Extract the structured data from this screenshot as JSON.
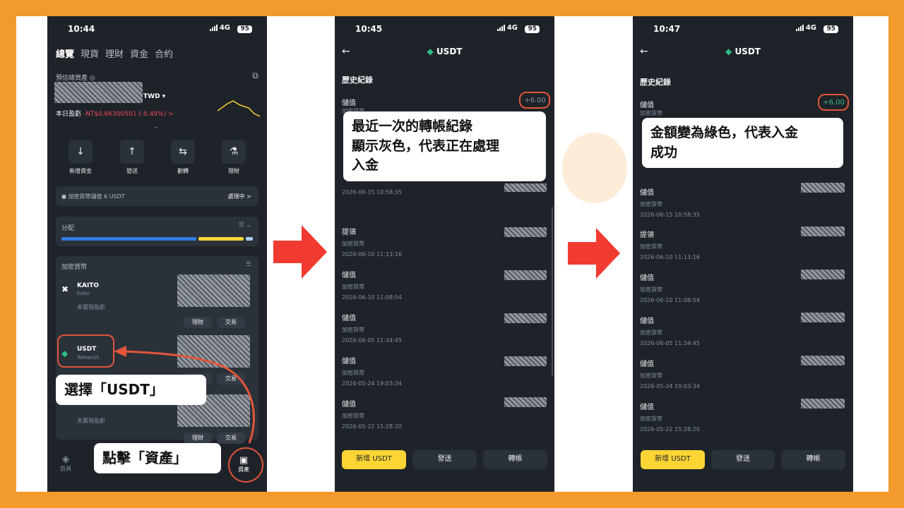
{
  "phone1": {
    "time": "10:44",
    "network": "4G",
    "battery": "95",
    "tabs": [
      "總覽",
      "現貨",
      "理財",
      "資金",
      "合約"
    ],
    "estimated_label": "預估總資產",
    "currency": "TWD ▾",
    "pnl_label": "本日盈虧",
    "pnl_value": "-NT$0.66300501 (-0.49%) >",
    "actions": [
      {
        "label": "新增資金",
        "icon": "↓"
      },
      {
        "label": "發送",
        "icon": "↑"
      },
      {
        "label": "劃轉",
        "icon": "⇆"
      },
      {
        "label": "理財",
        "icon": "⚗"
      }
    ],
    "notice_text": "● 加密貨幣儲值 6 USDT",
    "notice_status": "處理中 >",
    "allocation_label": "分配",
    "crypto_label": "加密貨幣",
    "coins": [
      {
        "name": "KAITO",
        "sub": "Kaito",
        "pnl": "未實現盈虧",
        "btn1": "理財",
        "btn2": "交易"
      },
      {
        "name": "USDT",
        "sub": "TetherUS",
        "btn1": "理財",
        "btn2": "交易"
      },
      {
        "pnl": "未實現盈虧",
        "btn1": "理財",
        "btn2": "交易"
      }
    ],
    "nav_home": "首頁",
    "nav_assets": "資產"
  },
  "phone2": {
    "time": "10:45",
    "network": "4G",
    "battery": "95",
    "title": "USDT",
    "history_label": "歷史紀錄",
    "first_type": "儲值",
    "first_amount": "+6.00",
    "first_sub": "加密貨幣",
    "records": [
      {
        "type": "儲值",
        "sub": "加密貨幣",
        "time": "2026-06-15 10:58:35"
      },
      {
        "type": "提領",
        "sub": "加密貨幣",
        "time": "2026-06-10 11:13:16"
      },
      {
        "type": "儲值",
        "sub": "加密貨幣",
        "time": "2026-06-10 11:08:54"
      },
      {
        "type": "儲值",
        "sub": "加密貨幣",
        "time": "2026-06-05 11:34:45"
      },
      {
        "type": "儲值",
        "sub": "加密貨幣",
        "time": "2026-05-24 19:03:34"
      },
      {
        "type": "儲值",
        "sub": "加密貨幣",
        "time": "2026-05-22 15:28:20"
      }
    ],
    "btn_add": "新增 USDT",
    "btn_send": "發送",
    "btn_transfer": "轉帳"
  },
  "phone3": {
    "time": "10:47",
    "network": "4G",
    "battery": "95",
    "title": "USDT",
    "history_label": "歷史紀錄",
    "first_type": "儲值",
    "first_amount": "+6.00",
    "first_sub": "加密貨幣",
    "records": [
      {
        "type": "儲值",
        "sub": "加密貨幣",
        "time": "2026-06-15 10:58:35"
      },
      {
        "type": "提領",
        "sub": "加密貨幣",
        "time": "2026-06-10 11:13:16"
      },
      {
        "type": "儲值",
        "sub": "加密貨幣",
        "time": "2026-06-10 11:08:54"
      },
      {
        "type": "儲值",
        "sub": "加密貨幣",
        "time": "2026-06-05 11:34:45"
      },
      {
        "type": "儲值",
        "sub": "加密貨幣",
        "time": "2026-05-24 19:03:34"
      },
      {
        "type": "儲值",
        "sub": "加密貨幣",
        "time": "2026-05-22 15:28:20"
      }
    ],
    "btn_add": "新增 USDT",
    "btn_send": "發送",
    "btn_transfer": "轉帳"
  },
  "callouts": {
    "select_usdt": "選擇「USDT」",
    "click_assets": "點擊「資產」",
    "gray_line1": "最近一次的轉帳紀錄",
    "gray_line2": "顯示灰色，代表正在處理",
    "gray_line3": "入金",
    "green_line1": "金額變為綠色，代表入金",
    "green_line2": "成功"
  },
  "colors": {
    "background": "#f39a2e",
    "phone_bg": "#1e2329",
    "card_bg": "#2b3139",
    "accent_yellow": "#fcd535",
    "highlight_red": "#e2553b",
    "pending_gray": "#848e9c",
    "success_green": "#2ebd85",
    "loss_red": "#f6465d"
  }
}
